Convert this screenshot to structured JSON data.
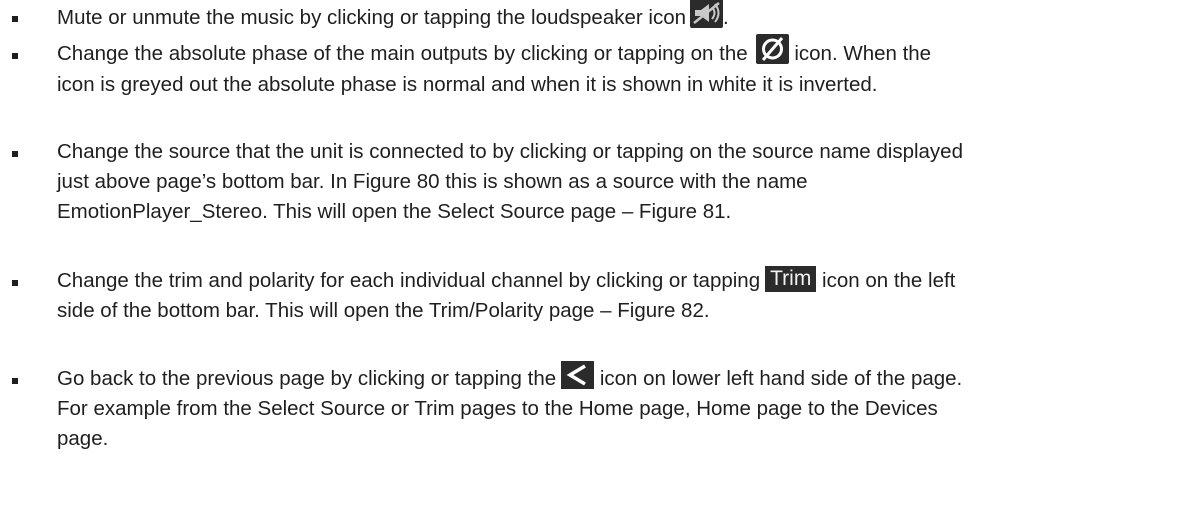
{
  "bullets": [
    {
      "lines": [
        "Mute or unmute the music by clicking or tapping the loudspeaker icon",
        "."
      ]
    },
    {
      "lines": [
        "Change the absolute phase of the main outputs by clicking or tapping on the",
        "icon.  When the",
        "icon is greyed out the absolute phase is normal and when it is shown in white it is inverted."
      ]
    },
    {
      "lines": [
        "Change the source that the unit is connected to by clicking or tapping on the source name displayed",
        "just above page’s bottom bar.  In Figure 80 this is shown as a source with the name",
        "EmotionPlayer_Stereo.  This will open the Select Source page – Figure 81."
      ]
    },
    {
      "lines": [
        "Change the trim and polarity for each individual channel by clicking or tapping",
        "icon on the left",
        "side of the bottom bar.  This will open the Trim/Polarity page – Figure 82."
      ]
    },
    {
      "lines": [
        "Go back to the previous page by clicking or tapping the",
        "icon on lower left hand side of the page.",
        "For example from the Select Source or Trim pages to the Home page, Home page to the Devices",
        "page."
      ]
    }
  ],
  "icons": {
    "mute": "loudspeaker-muted-icon",
    "phase": "phase-invert-icon",
    "trim_label": "Trim",
    "back": "back-chevron-icon"
  },
  "colors": {
    "icon_background": "#2b2b2b",
    "icon_foreground": "#f2f2f2",
    "text": "#1f1f1f"
  }
}
